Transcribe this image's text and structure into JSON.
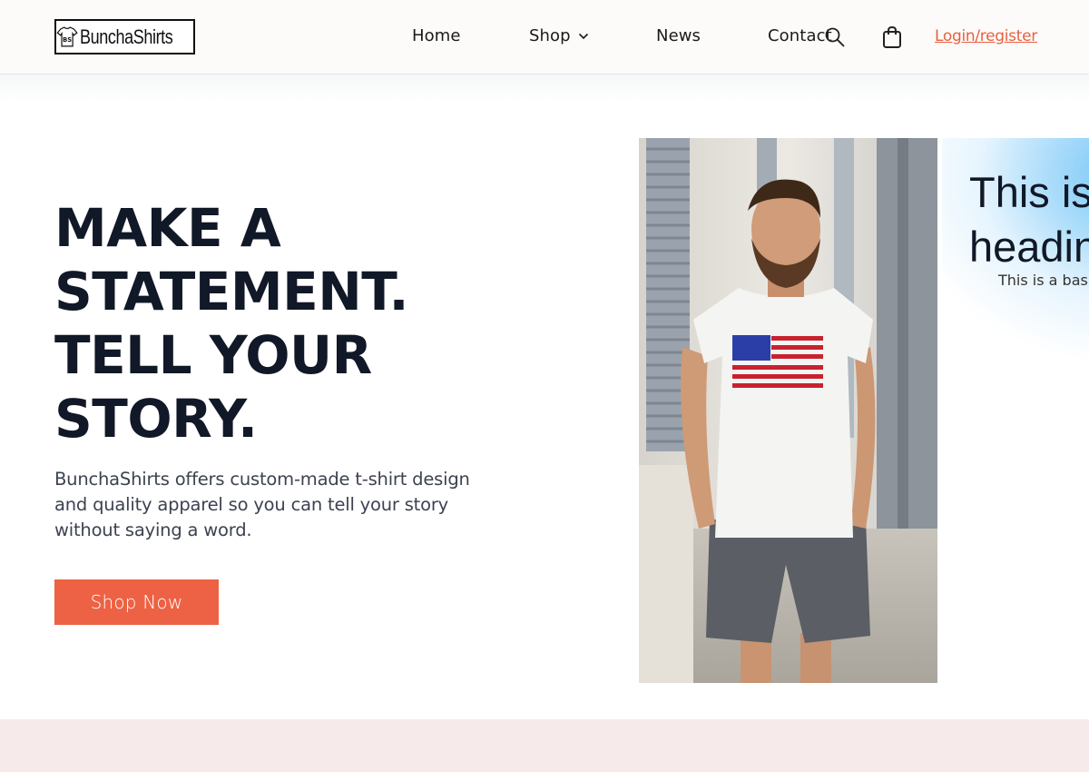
{
  "header": {
    "logo_text": "BunchaShirts",
    "nav": [
      {
        "label": "Home"
      },
      {
        "label": "Shop"
      },
      {
        "label": "News"
      },
      {
        "label": "Contact"
      }
    ],
    "icons": {
      "search": "search-icon",
      "cart": "shopping-bag-icon",
      "dropdown": "chevron-down-icon"
    },
    "login_label": "Login/register"
  },
  "hero": {
    "title_lines": [
      "MAKE A",
      "STATEMENT.",
      "TELL YOUR",
      "STORY."
    ],
    "description": "BunchaShirts offers custom-made t-shirt design and quality apparel so you can tell your story without saying a word.",
    "cta_label": "Shop Now"
  },
  "slide": {
    "heading_line1": "This is",
    "heading_line2": "heading",
    "text": "This is a basic"
  },
  "colors": {
    "accent": "#ed6244",
    "login_link": "#e8603f",
    "heading_text": "#111827",
    "footer_band": "#f7eaea"
  }
}
